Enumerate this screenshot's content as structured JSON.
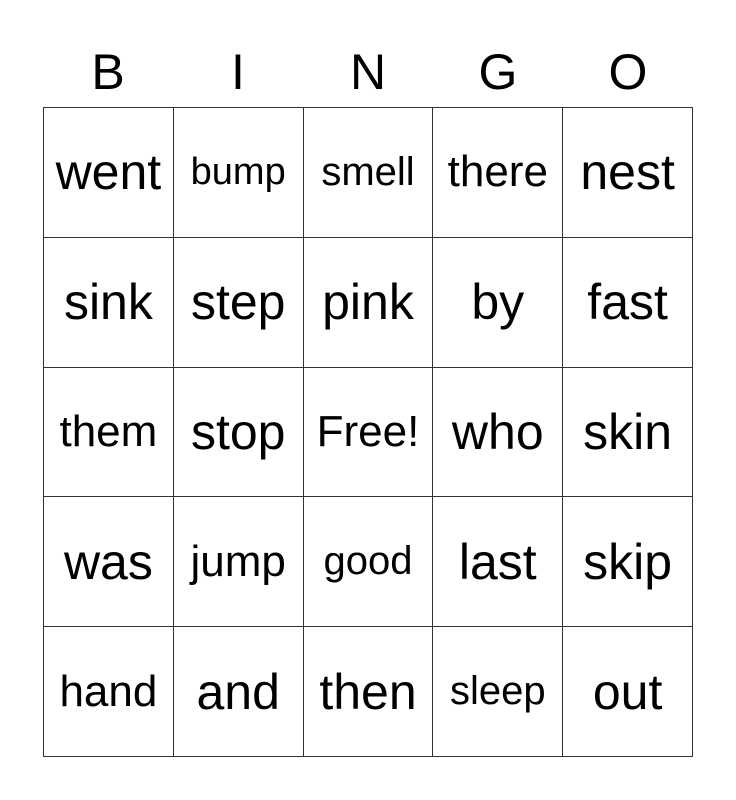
{
  "header": [
    "B",
    "I",
    "N",
    "G",
    "O"
  ],
  "grid": [
    [
      "went",
      "bump",
      "smell",
      "there",
      "nest"
    ],
    [
      "sink",
      "step",
      "pink",
      "by",
      "fast"
    ],
    [
      "them",
      "stop",
      "Free!",
      "who",
      "skin"
    ],
    [
      "was",
      "jump",
      "good",
      "last",
      "skip"
    ],
    [
      "hand",
      "and",
      "then",
      "sleep",
      "out"
    ]
  ]
}
